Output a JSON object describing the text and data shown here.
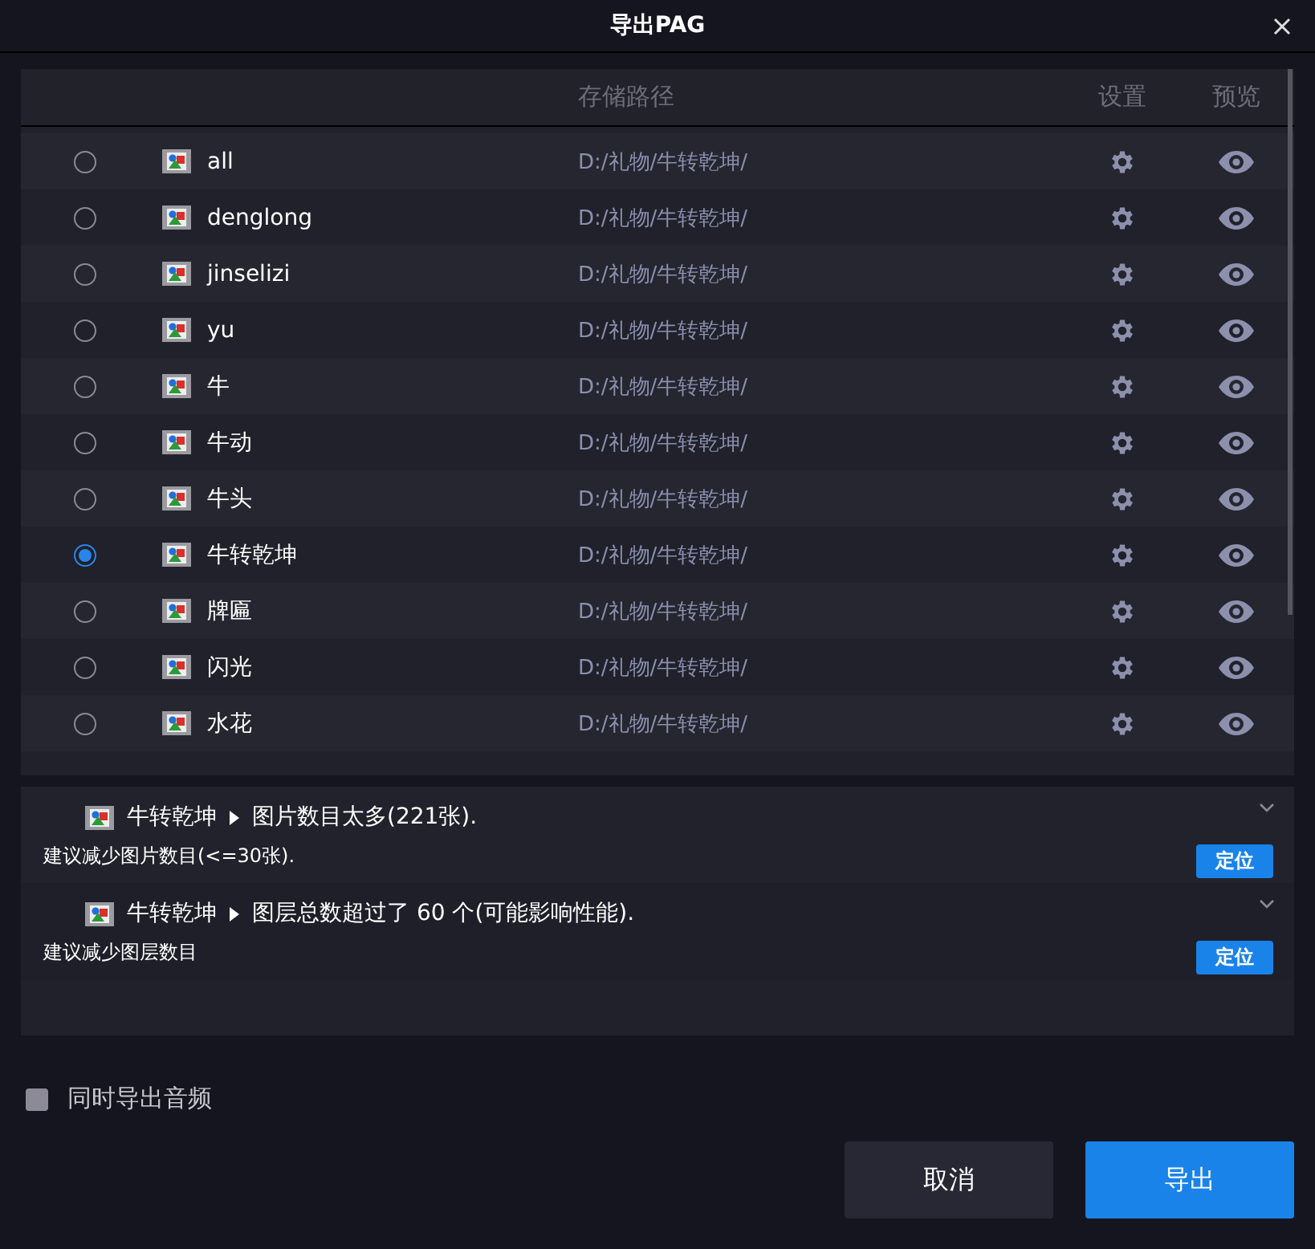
{
  "window": {
    "title": "导出PAG"
  },
  "table": {
    "columns": [
      "存储路径",
      "设置",
      "预览"
    ],
    "rows": [
      {
        "name": "all",
        "path": "D:/礼物/牛转乾坤/",
        "selected": false
      },
      {
        "name": "denglong",
        "path": "D:/礼物/牛转乾坤/",
        "selected": false
      },
      {
        "name": "jinselizi",
        "path": "D:/礼物/牛转乾坤/",
        "selected": false
      },
      {
        "name": "yu",
        "path": "D:/礼物/牛转乾坤/",
        "selected": false
      },
      {
        "name": "牛",
        "path": "D:/礼物/牛转乾坤/",
        "selected": false
      },
      {
        "name": "牛动",
        "path": "D:/礼物/牛转乾坤/",
        "selected": false
      },
      {
        "name": "牛头",
        "path": "D:/礼物/牛转乾坤/",
        "selected": false
      },
      {
        "name": "牛转乾坤",
        "path": "D:/礼物/牛转乾坤/",
        "selected": true
      },
      {
        "name": "牌匾",
        "path": "D:/礼物/牛转乾坤/",
        "selected": false
      },
      {
        "name": "闪光",
        "path": "D:/礼物/牛转乾坤/",
        "selected": false
      },
      {
        "name": "水花",
        "path": "D:/礼物/牛转乾坤/",
        "selected": false
      }
    ]
  },
  "warnings": [
    {
      "layer": "牛转乾坤",
      "message": "图片数目太多(221张).",
      "suggestion": "建议减少图片数目(<=30张).",
      "button": "定位"
    },
    {
      "layer": "牛转乾坤",
      "message": "图层总数超过了 60 个(可能影响性能).",
      "suggestion": "建议减少图层数目",
      "button": "定位"
    }
  ],
  "audio": {
    "label": "同时导出音频",
    "checked": false
  },
  "buttons": {
    "cancel": "取消",
    "export": "导出"
  }
}
